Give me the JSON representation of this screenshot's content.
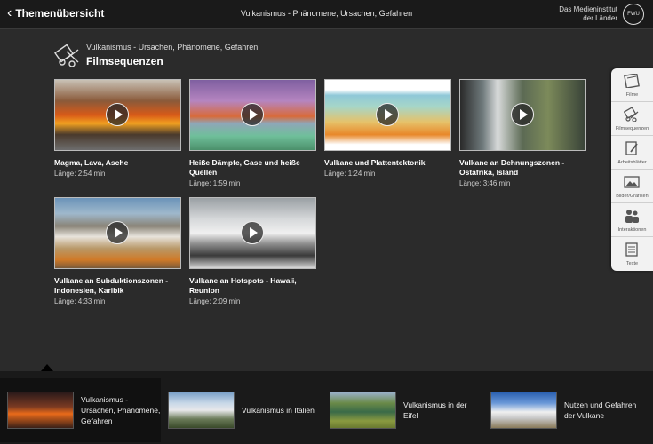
{
  "topbar": {
    "back_label": "Themenübersicht",
    "title": "Vulkanismus - Phänomene, Ursachen, Gefahren",
    "brand_line1": "Das Medieninstitut",
    "brand_line2": "der Länder",
    "logo_text": "FWU"
  },
  "section": {
    "subtitle": "Vulkanismus - Ursachen, Phänomene, Gefahren",
    "title": "Filmsequenzen"
  },
  "cards": [
    {
      "title": "Magma, Lava, Asche",
      "length": "Länge: 2:54 min"
    },
    {
      "title": "Heiße Dämpfe, Gase und heiße Quellen",
      "length": "Länge: 1:59 min"
    },
    {
      "title": "Vulkane und Plattentektonik",
      "length": "Länge: 1:24 min"
    },
    {
      "title": "Vulkane an Dehnungszonen - Ostafrika, Island",
      "length": "Länge: 3:46 min"
    },
    {
      "title": "Vulkane an Subduktionszonen - Indonesien, Karibik",
      "length": "Länge: 4:33 min"
    },
    {
      "title": "Vulkane an Hotspots - Hawaii, Reunion",
      "length": "Länge: 2:09 min"
    }
  ],
  "sidebar": {
    "items": [
      {
        "label": "Filme",
        "icon": "film-icon"
      },
      {
        "label": "Filmsequenzen",
        "icon": "film-clips-icon"
      },
      {
        "label": "Arbeitsblätter",
        "icon": "worksheet-icon"
      },
      {
        "label": "Bilder/Grafiken",
        "icon": "image-icon"
      },
      {
        "label": "Interaktionen",
        "icon": "people-icon"
      },
      {
        "label": "Texte",
        "icon": "document-icon"
      }
    ]
  },
  "bottom_nav": {
    "items": [
      {
        "label": "Vulkanismus - Ursachen, Phänomene, Gefahren",
        "active": true
      },
      {
        "label": "Vulkanismus in Italien",
        "active": false
      },
      {
        "label": "Vulkanismus in der Eifel",
        "active": false
      },
      {
        "label": "Nutzen und Gefahren der Vulkane",
        "active": false
      }
    ]
  }
}
